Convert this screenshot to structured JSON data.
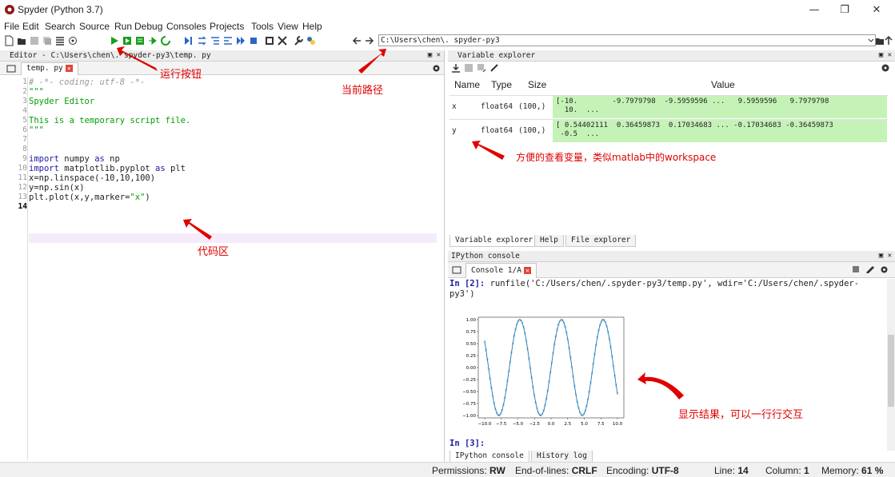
{
  "window": {
    "title": "Spyder (Python 3.7)"
  },
  "menu": [
    "File",
    "Edit",
    "Search",
    "Source",
    "Run",
    "Debug",
    "Consoles",
    "Projects",
    "Tools",
    "View",
    "Help"
  ],
  "toolbar": {
    "path": "C:\\Users\\chen\\. spyder-py3"
  },
  "editor": {
    "pane_title": "Editor - C:\\Users\\chen\\. spyder-py3\\temp. py",
    "tab": "temp. py",
    "code_lines": [
      {
        "n": "1",
        "t": "# -*- coding: utf-8 -*-",
        "cls": "cm"
      },
      {
        "n": "2",
        "t": "\"\"\"",
        "cls": "st"
      },
      {
        "n": "3",
        "t": "Spyder Editor",
        "cls": "st"
      },
      {
        "n": "4",
        "t": "",
        "cls": "st"
      },
      {
        "n": "5",
        "t": "This is a temporary script file.",
        "cls": "st"
      },
      {
        "n": "6",
        "t": "\"\"\"",
        "cls": "st"
      },
      {
        "n": "7",
        "t": "",
        "cls": ""
      },
      {
        "n": "8",
        "t": "",
        "cls": ""
      },
      {
        "n": "9",
        "t": "import numpy as np",
        "cls": ""
      },
      {
        "n": "10",
        "t": "import matplotlib.pyplot as plt",
        "cls": ""
      },
      {
        "n": "11",
        "t": "x=np.linspace(-10,10,100)",
        "cls": ""
      },
      {
        "n": "12",
        "t": "y=np.sin(x)",
        "cls": ""
      },
      {
        "n": "13",
        "t": "plt.plot(x,y,marker=\"x\")",
        "cls": ""
      },
      {
        "n": "14",
        "t": "",
        "cls": ""
      }
    ]
  },
  "annotations": {
    "run_button": "运行按钮",
    "current_path": "当前路径",
    "code_area": "代码区",
    "variables": "方便的查看变量，类似matlab中的workspace",
    "results": "显示结果，可以一行行交互"
  },
  "variable_explorer": {
    "pane_title": "Variable explorer",
    "columns": [
      "Name",
      "Type",
      "Size",
      "Value"
    ],
    "rows": [
      {
        "name": "x",
        "type": "float64",
        "size": "(100,)",
        "value": "[-10.        -9.7979798  -9.5959596 ...   9.5959596   9.7979798\n  10.  ..."
      },
      {
        "name": "y",
        "type": "float64",
        "size": "(100,)",
        "value": "[ 0.54402111  0.36459873  0.17034683 ... -0.17034683 -0.36459873\n -0.5  ..."
      }
    ],
    "tabs": [
      "Variable explorer",
      "Help",
      "File explorer"
    ]
  },
  "ipython": {
    "pane_title": "IPython console",
    "tab": "Console 1/A",
    "prompt2": "In [2]:",
    "cmd_line1": " runfile('C:/Users/chen/.spyder-py3/temp.py', wdir='C:/Users/chen/.spyder-",
    "cmd_line2": "py3')",
    "prompt3": "In [3]:",
    "tabs": [
      "IPython console",
      "History log"
    ]
  },
  "chart_data": {
    "type": "line",
    "series": [
      {
        "function": "sin(x)",
        "x_start": -10,
        "x_end": 10,
        "points": 100,
        "marker": "x"
      }
    ],
    "xticks": [
      "−10.0",
      "−7.5",
      "−5.0",
      "−2.5",
      "0.0",
      "2.5",
      "5.0",
      "7.5",
      "10.0"
    ],
    "yticks": [
      "1.00",
      "0.75",
      "0.50",
      "0.25",
      "0.00",
      "−0.25",
      "−0.50",
      "−0.75",
      "−1.00"
    ],
    "xlim": [
      -10,
      10
    ],
    "ylim": [
      -1.05,
      1.05
    ],
    "color": "#1f77b4"
  },
  "status": {
    "permissions_label": "Permissions:",
    "permissions": "RW",
    "eol_label": "End-of-lines:",
    "eol": "CRLF",
    "encoding_label": "Encoding:",
    "encoding": "UTF-8",
    "line_label": "Line:",
    "line": "14",
    "column_label": "Column:",
    "column": "1",
    "memory_label": "Memory:",
    "memory": "61 %"
  },
  "colors": {
    "annotation": "#e00000",
    "value_bg": "#c5f3b7",
    "current_line": "#f5ebf9"
  }
}
